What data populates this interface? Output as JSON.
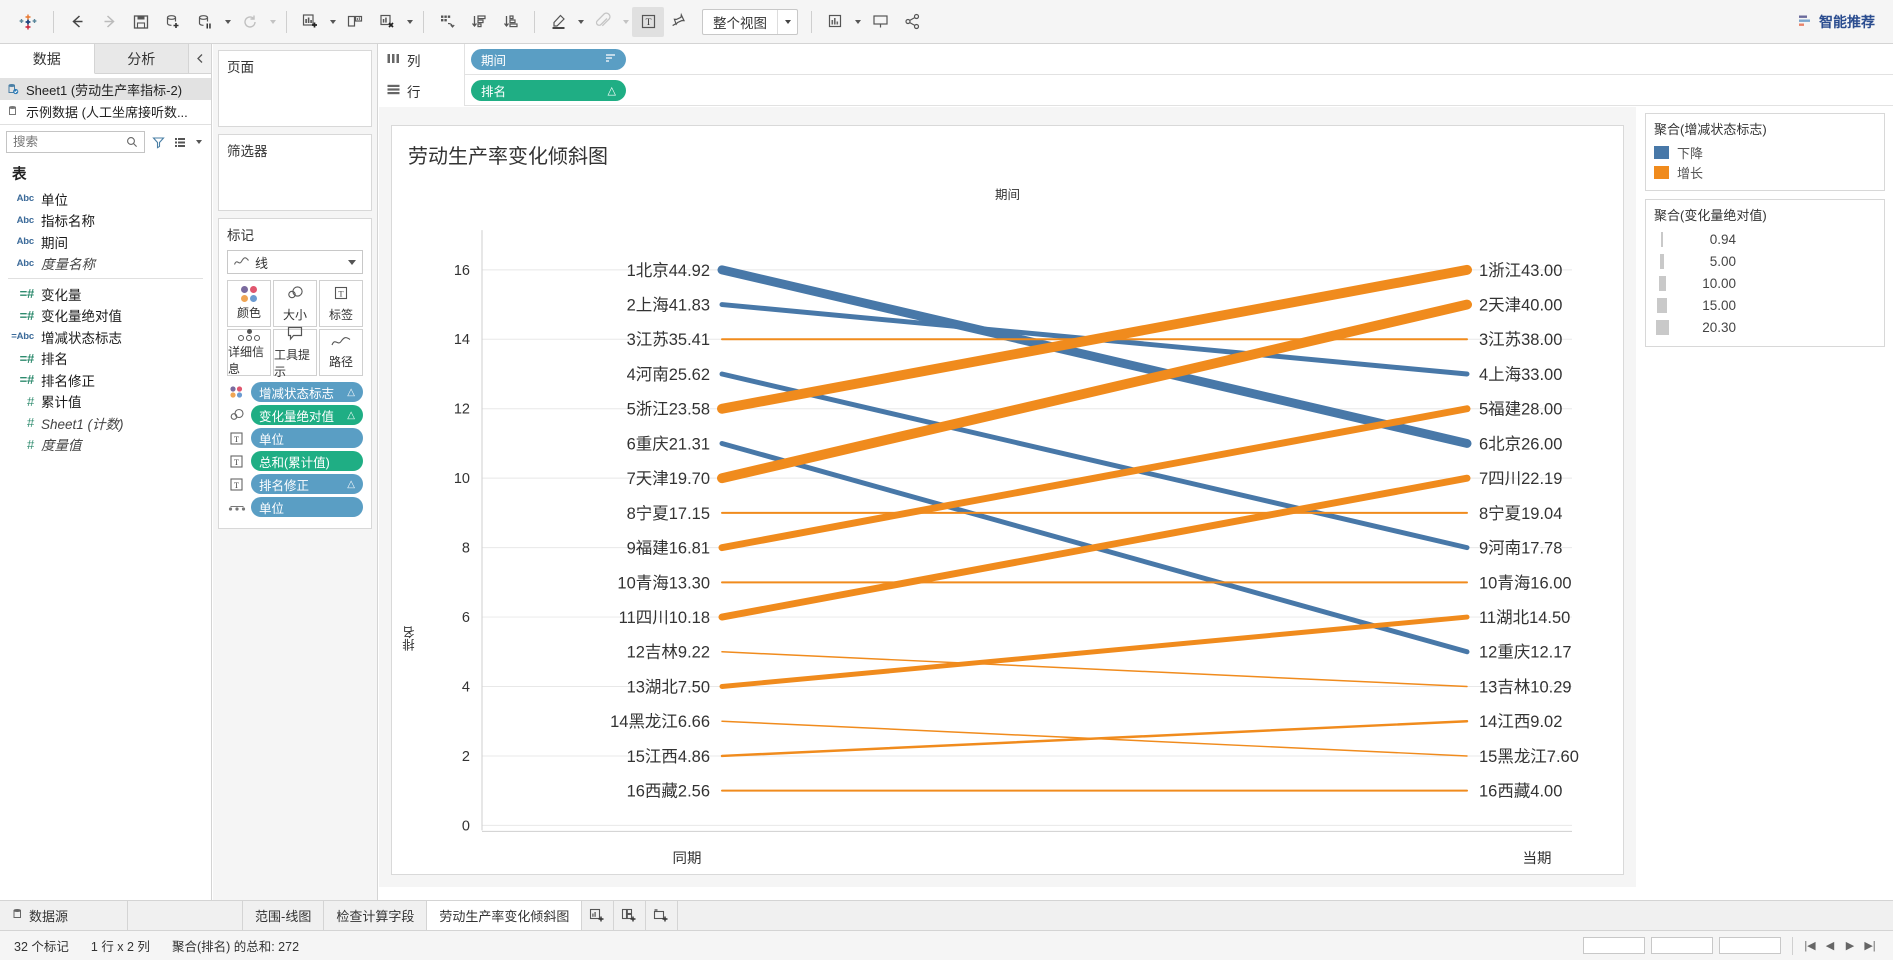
{
  "toolbar": {
    "view_select": "整个视图",
    "smart_recommend": "智能推荐",
    "icons": [
      "tableau-logo-icon",
      "back-arrow-icon",
      "forward-arrow-icon",
      "save-icon",
      "add-datasource-icon",
      "pause-datasource-icon",
      "refresh-icon",
      "new-worksheet-icon",
      "new-dashboard-icon",
      "clear-sheet-icon",
      "swap-rows-cols-icon",
      "sort-ascending-icon",
      "sort-descending-icon",
      "highlight-icon",
      "attach-icon",
      "show-labels-icon",
      "fix-axes-icon",
      "presentation-icon",
      "share-icon"
    ]
  },
  "left_pane": {
    "tabs": [
      {
        "label": "数据",
        "active": true
      },
      {
        "label": "分析",
        "active": false
      }
    ],
    "collapse_icon": "chevron-left-icon",
    "datasources": [
      {
        "label": "Sheet1 (劳动生产率指标-2)",
        "selected": true
      },
      {
        "label": "示例数据 (人工坐席接听数...",
        "selected": false
      }
    ],
    "search_placeholder": "搜索",
    "section_title": "表",
    "fields": [
      {
        "label": "单位",
        "type": "abc",
        "glyph": "Abc",
        "italic": false
      },
      {
        "label": "指标名称",
        "type": "abc",
        "glyph": "Abc",
        "italic": false
      },
      {
        "label": "期间",
        "type": "abc",
        "glyph": "Abc",
        "italic": false
      },
      {
        "label": "度量名称",
        "type": "abc",
        "glyph": "Abc",
        "italic": true
      },
      {
        "label": "变化量",
        "type": "calcnum",
        "glyph": "=#",
        "italic": false,
        "after_divider": true
      },
      {
        "label": "变化量绝对值",
        "type": "calcnum",
        "glyph": "=#",
        "italic": false
      },
      {
        "label": "增减状态标志",
        "type": "calcabc",
        "glyph": "=Abc",
        "italic": false
      },
      {
        "label": "排名",
        "type": "calcnum",
        "glyph": "=#",
        "italic": false
      },
      {
        "label": "排名修正",
        "type": "calcnum",
        "glyph": "=#",
        "italic": false
      },
      {
        "label": "累计值",
        "type": "num",
        "glyph": "#",
        "italic": false
      },
      {
        "label": "Sheet1 (计数)",
        "type": "num",
        "glyph": "#",
        "italic": true
      },
      {
        "label": "度量值",
        "type": "num",
        "glyph": "#",
        "italic": true
      }
    ]
  },
  "cards": {
    "pages_title": "页面",
    "filters_title": "筛选器",
    "marks_title": "标记",
    "marks_type": "线",
    "marks_type_icon": "line-chart-icon",
    "buttons": [
      {
        "label": "颜色",
        "icon": "color-palette-icon"
      },
      {
        "label": "大小",
        "icon": "size-circles-icon"
      },
      {
        "label": "标签",
        "icon": "label-icon"
      },
      {
        "label": "详细信息",
        "icon": "detail-dots-icon"
      },
      {
        "label": "工具提示",
        "icon": "tooltip-icon"
      },
      {
        "label": "路径",
        "icon": "path-icon"
      }
    ],
    "pills": [
      {
        "label": "增减状态标志",
        "color": "blue",
        "icon": "color-palette-icon",
        "delta": "△"
      },
      {
        "label": "变化量绝对值",
        "color": "green",
        "icon": "size-circles-icon",
        "delta": "△"
      },
      {
        "label": "单位",
        "color": "blue",
        "icon": "text-label-icon",
        "delta": ""
      },
      {
        "label": "总和(累计值)",
        "color": "green",
        "icon": "text-label-icon",
        "delta": ""
      },
      {
        "label": "排名修正",
        "color": "blue",
        "icon": "text-label-icon",
        "delta": "△"
      },
      {
        "label": "单位",
        "color": "blue",
        "icon": "path-icon",
        "delta": ""
      }
    ]
  },
  "shelves": {
    "columns_label": "列",
    "columns_icon": "columns-icon",
    "rows_label": "行",
    "rows_icon": "rows-icon",
    "columns_pill": {
      "label": "期间",
      "color": "blue",
      "sort": "sort-icon"
    },
    "rows_pill": {
      "label": "排名",
      "color": "green",
      "sort": "△"
    }
  },
  "legends": {
    "color_legend": {
      "title": "聚合(增减状态标志)",
      "items": [
        {
          "label": "下降",
          "color": "#4878a8"
        },
        {
          "label": "增长",
          "color": "#f08b1d"
        }
      ]
    },
    "size_legend": {
      "title": "聚合(变化量绝对值)",
      "items": [
        {
          "value": "0.94",
          "w": 2
        },
        {
          "value": "5.00",
          "w": 4
        },
        {
          "value": "10.00",
          "w": 7
        },
        {
          "value": "15.00",
          "w": 10
        },
        {
          "value": "20.30",
          "w": 13
        }
      ]
    }
  },
  "bottom": {
    "tabs": [
      {
        "label": "数据源",
        "icon": "datasource-icon",
        "active": false,
        "is_ds": true
      },
      {
        "label": "范围-线图",
        "active": false
      },
      {
        "label": "检查计算字段",
        "active": false
      },
      {
        "label": "劳动生产率变化倾斜图",
        "active": true
      }
    ],
    "new_buttons": [
      {
        "icon": "new-worksheet-icon"
      },
      {
        "icon": "new-dashboard-icon"
      },
      {
        "icon": "new-story-icon"
      }
    ],
    "status": {
      "marks": "32 个标记",
      "rowscols": "1 行 x 2 列",
      "aggregate": "聚合(排名) 的总和: 272"
    }
  },
  "chart_data": {
    "type": "line",
    "title": "劳动生产率变化倾斜图",
    "column_header": "期间",
    "xlabel": "",
    "ylabel": "排名",
    "ylim": [
      0,
      17
    ],
    "yticks": [
      0,
      2,
      4,
      6,
      8,
      10,
      12,
      14,
      16
    ],
    "grid": true,
    "x": [
      "同期",
      "当期"
    ],
    "colors": {
      "down": "#4878a8",
      "up": "#f08b1d"
    },
    "series": [
      {
        "name": "北京",
        "left_rank": 1,
        "left_value": "44.92",
        "right_rank": 6,
        "right_value": "26.00",
        "left_label": "1北京44.92",
        "right_label": "6北京26.00",
        "direction": "down",
        "width": 9
      },
      {
        "name": "上海",
        "left_rank": 2,
        "left_value": "41.83",
        "right_rank": 4,
        "right_value": "33.00",
        "left_label": "2上海41.83",
        "right_label": "4上海33.00",
        "direction": "down",
        "width": 5
      },
      {
        "name": "江苏",
        "left_rank": 3,
        "left_value": "35.41",
        "right_rank": 3,
        "right_value": "38.00",
        "left_label": "3江苏35.41",
        "right_label": "3江苏38.00",
        "direction": "up",
        "width": 2
      },
      {
        "name": "河南",
        "left_rank": 4,
        "left_value": "25.62",
        "right_rank": 9,
        "right_value": "17.78",
        "left_label": "4河南25.62",
        "right_label": "9河南17.78",
        "direction": "down",
        "width": 5
      },
      {
        "name": "浙江",
        "left_rank": 5,
        "left_value": "23.58",
        "right_rank": 1,
        "right_value": "43.00",
        "left_label": "5浙江23.58",
        "right_label": "1浙江43.00",
        "direction": "up",
        "width": 10
      },
      {
        "name": "重庆",
        "left_rank": 6,
        "left_value": "21.31",
        "right_rank": 12,
        "right_value": "12.17",
        "left_label": "6重庆21.31",
        "right_label": "12重庆12.17",
        "direction": "down",
        "width": 5
      },
      {
        "name": "天津",
        "left_rank": 7,
        "left_value": "19.70",
        "right_rank": 2,
        "right_value": "40.00",
        "left_label": "7天津19.70",
        "right_label": "2天津40.00",
        "direction": "up",
        "width": 10
      },
      {
        "name": "宁夏",
        "left_rank": 8,
        "left_value": "17.15",
        "right_rank": 8,
        "right_value": "19.04",
        "left_label": "8宁夏17.15",
        "right_label": "8宁夏19.04",
        "direction": "up",
        "width": 2
      },
      {
        "name": "福建",
        "left_rank": 9,
        "left_value": "16.81",
        "right_rank": 5,
        "right_value": "28.00",
        "left_label": "9福建16.81",
        "right_label": "5福建28.00",
        "direction": "up",
        "width": 7
      },
      {
        "name": "青海",
        "left_rank": 10,
        "left_value": "13.30",
        "right_rank": 10,
        "right_value": "16.00",
        "left_label": "10青海13.30",
        "right_label": "10青海16.00",
        "direction": "up",
        "width": 2
      },
      {
        "name": "四川",
        "left_rank": 11,
        "left_value": "10.18",
        "right_rank": 7,
        "right_value": "22.19",
        "left_label": "11四川10.18",
        "right_label": "7四川22.19",
        "direction": "up",
        "width": 7
      },
      {
        "name": "吉林",
        "left_rank": 12,
        "left_value": "9.22",
        "right_rank": 13,
        "right_value": "10.29",
        "left_label": "12吉林9.22",
        "right_label": "13吉林10.29",
        "direction": "up",
        "width": 1.5
      },
      {
        "name": "湖北",
        "left_rank": 13,
        "left_value": "7.50",
        "right_rank": 11,
        "right_value": "14.50",
        "left_label": "13湖北7.50",
        "right_label": "11湖北14.50",
        "direction": "up",
        "width": 5
      },
      {
        "name": "黑龙江",
        "left_rank": 14,
        "left_value": "6.66",
        "right_rank": 15,
        "right_value": "7.60",
        "left_label": "14黑龙江6.66",
        "right_label": "15黑龙江7.60",
        "direction": "up",
        "width": 1.5
      },
      {
        "name": "江西",
        "left_rank": 15,
        "left_value": "4.86",
        "right_rank": 14,
        "right_value": "9.02",
        "left_label": "15江西4.86",
        "right_label": "14江西9.02",
        "direction": "up",
        "width": 2.5
      },
      {
        "name": "西藏",
        "left_rank": 16,
        "left_value": "2.56",
        "right_rank": 16,
        "right_value": "4.00",
        "left_label": "16西藏2.56",
        "right_label": "16西藏4.00",
        "direction": "up",
        "width": 2
      }
    ]
  }
}
